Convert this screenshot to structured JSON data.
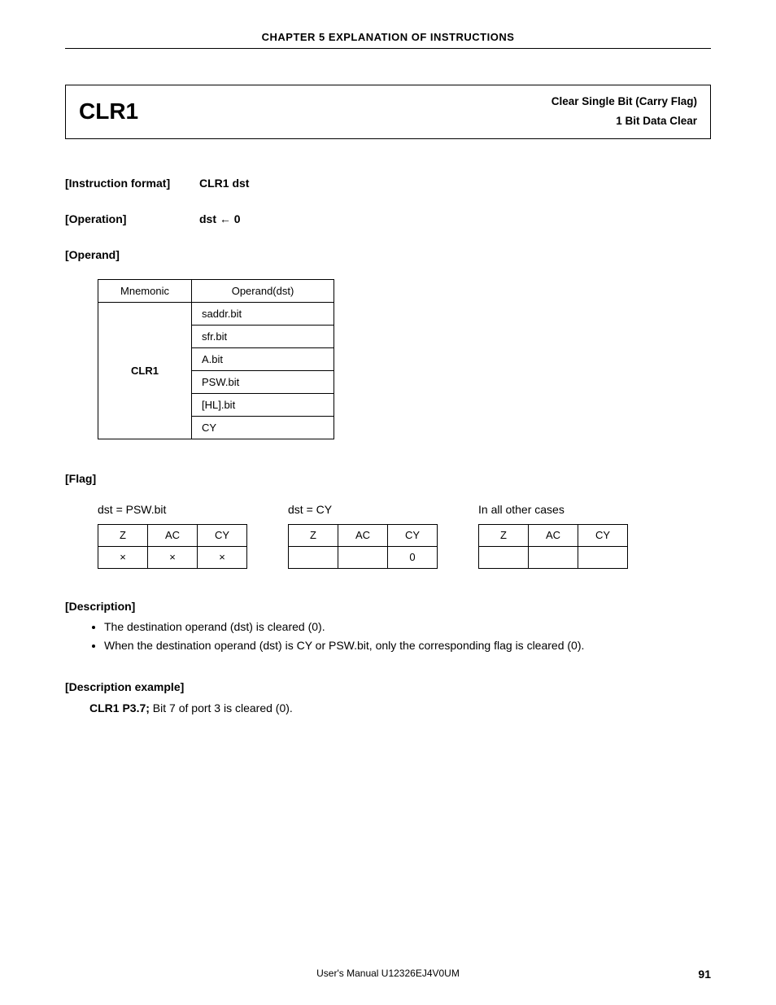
{
  "chapterHeader": "CHAPTER 5  EXPLANATION OF INSTRUCTIONS",
  "topBox": {
    "mnemonic": "CLR1",
    "title": "Clear Single Bit (Carry Flag)",
    "subtitle": "1 Bit Data Clear"
  },
  "instructionFormat": {
    "label": "[Instruction format]",
    "value": "CLR1 dst"
  },
  "operation": {
    "label": "[Operation]",
    "value": "dst ← 0"
  },
  "operand": {
    "label": "[Operand]",
    "headers": {
      "mnemonic": "Mnemonic",
      "operand": "Operand(dst)"
    },
    "mnemonic": "CLR1",
    "items": [
      "saddr.bit",
      "sfr.bit",
      "A.bit",
      "PSW.bit",
      "[HL].bit",
      "CY"
    ]
  },
  "flag": {
    "label": "[Flag]",
    "columns": {
      "z": "Z",
      "ac": "AC",
      "cy": "CY"
    },
    "groups": [
      {
        "caption": "dst = PSW.bit",
        "z": "×",
        "ac": "×",
        "cy": "×"
      },
      {
        "caption": "dst = CY",
        "z": "",
        "ac": "",
        "cy": "0"
      },
      {
        "caption": "In all other cases",
        "z": "",
        "ac": "",
        "cy": ""
      }
    ]
  },
  "description": {
    "label": "[Description]",
    "items": [
      "The destination operand (dst) is cleared (0).",
      "When the destination operand (dst) is CY or PSW.bit, only the corresponding flag is cleared (0)."
    ]
  },
  "example": {
    "label": "[Description example]",
    "code": "CLR1 P3.7;",
    "text": "  Bit 7 of port 3 is cleared (0)."
  },
  "footer": {
    "center": "User's Manual  U12326EJ4V0UM",
    "page": "91"
  }
}
